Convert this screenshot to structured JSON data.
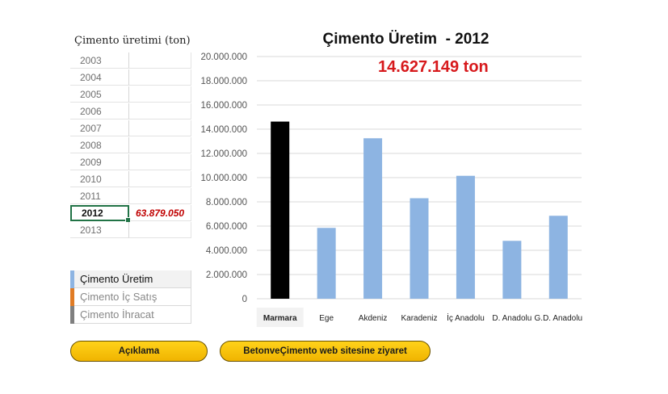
{
  "left_panel": {
    "title": "Çimento üretimi (ton)",
    "years": [
      "2003",
      "2004",
      "2005",
      "2006",
      "2007",
      "2008",
      "2009",
      "2010",
      "2011",
      "2012",
      "2013"
    ],
    "selected_year": "2012",
    "selected_value": "63.879.050"
  },
  "legend": {
    "items": [
      {
        "label": "Çimento Üretim",
        "color": "#8db4e2",
        "active": true
      },
      {
        "label": "Çimento İç Satış",
        "color": "#e07b24",
        "active": false
      },
      {
        "label": "Çimento İhracat",
        "color": "#7f7f7f",
        "active": false
      }
    ]
  },
  "chart": {
    "title": "Çimento Üretim  - 2012",
    "total_label": "14.627.149 ton",
    "highlight_category": "Marmara",
    "highlight_color": "#000000",
    "bar_color": "#8db4e2",
    "gridline_color": "#d9d9d9"
  },
  "chart_data": {
    "type": "bar",
    "title": "Çimento Üretim  - 2012",
    "categories": [
      "Marmara",
      "Ege",
      "Akdeniz",
      "Karadeniz",
      "İç Anadolu",
      "D. Anadolu",
      "G.D. Anadolu"
    ],
    "values": [
      14627149,
      5850000,
      13250000,
      8300000,
      10150000,
      4780000,
      6850000
    ],
    "ylim": [
      0,
      20000000
    ],
    "yticks": [
      "0",
      "2.000.000",
      "4.000.000",
      "6.000.000",
      "8.000.000",
      "10.000.000",
      "12.000.000",
      "14.000.000",
      "16.000.000",
      "18.000.000",
      "20.000.000"
    ],
    "ytick_values": [
      0,
      2000000,
      4000000,
      6000000,
      8000000,
      10000000,
      12000000,
      14000000,
      16000000,
      18000000,
      20000000
    ],
    "grid": true
  },
  "buttons": {
    "aciklama": "Açıklama",
    "website": "BetonveÇimento web sitesine ziyaret"
  }
}
